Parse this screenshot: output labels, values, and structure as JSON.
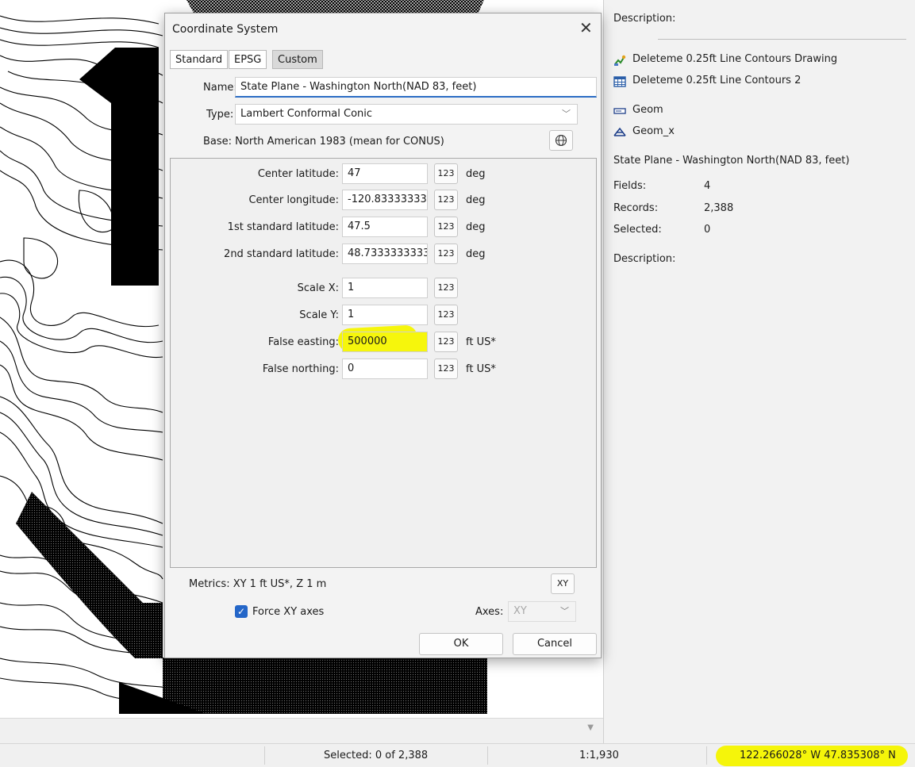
{
  "dialog": {
    "title": "Coordinate System",
    "close_glyph": "✕",
    "tabs": [
      {
        "label": "Standard",
        "active": false
      },
      {
        "label": "EPSG",
        "active": false
      },
      {
        "label": "Custom",
        "active": true
      }
    ],
    "name_label": "Name:",
    "name_value": "State Plane - Washington North(NAD 83, feet)",
    "type_label": "Type:",
    "type_value": "Lambert Conformal Conic",
    "base_text": "Base: North American 1983 (mean for CONUS)",
    "params": [
      {
        "label": "Center latitude:",
        "value": "47",
        "unit": "deg"
      },
      {
        "label": "Center longitude:",
        "value": "-120.83333333",
        "unit": "deg"
      },
      {
        "label": "1st standard latitude:",
        "value": "47.5",
        "unit": "deg"
      },
      {
        "label": "2nd standard latitude:",
        "value": "48.7333333333",
        "unit": "deg"
      },
      {
        "label": "Scale X:",
        "value": "1",
        "unit": ""
      },
      {
        "label": "Scale Y:",
        "value": "1",
        "unit": ""
      },
      {
        "label": "False easting:",
        "value": "500000",
        "unit": "ft US*"
      },
      {
        "label": "False northing:",
        "value": "0",
        "unit": "ft US*"
      }
    ],
    "unit_button_label": "123",
    "metrics_text": "Metrics: XY 1 ft US*, Z 1 m",
    "xy_button_label": "XY",
    "force_xy_label": "Force XY axes",
    "force_xy_checked": true,
    "axes_label": "Axes:",
    "axes_value": "XY",
    "ok_label": "OK",
    "cancel_label": "Cancel"
  },
  "right_panel": {
    "description_top_label": "Description:",
    "items": [
      {
        "label": "Deleteme 0.25ft Line Contours Drawing",
        "icon": "drawing-icon"
      },
      {
        "label": "Deleteme 0.25ft Line Contours 2",
        "icon": "table-icon"
      }
    ],
    "geom_label": "Geom",
    "geom_x_label": "Geom_x",
    "cs_name": "State Plane - Washington North(NAD 83, feet)",
    "fields_label": "Fields:",
    "fields_value": "4",
    "records_label": "Records:",
    "records_value": "2,388",
    "selected_label": "Selected:",
    "selected_value": "0",
    "description_label": "Description:"
  },
  "status_bar": {
    "selected_text": "Selected: 0 of 2,388",
    "scale_text": "1:1,930",
    "coords_text": "122.266028° W 47.835308° N"
  },
  "colors": {
    "highlight": "#f5f50a",
    "accent": "#2466c8"
  }
}
